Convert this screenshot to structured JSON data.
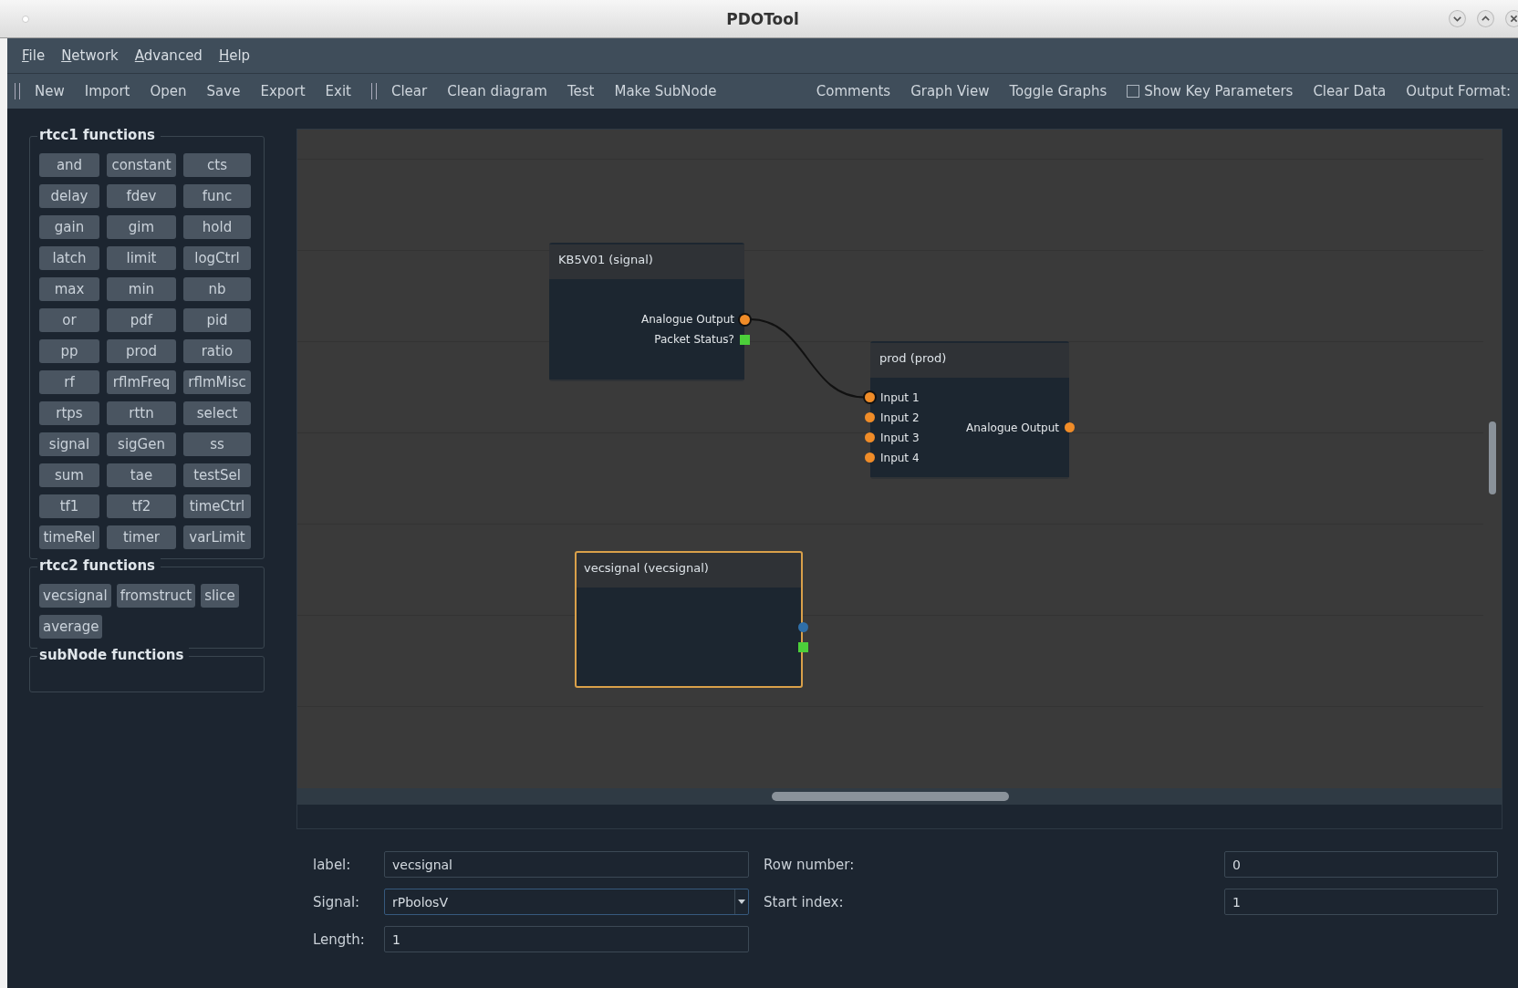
{
  "window": {
    "title": "PDOTool"
  },
  "menu": [
    "File",
    "Network",
    "Advanced",
    "Help"
  ],
  "toolbar": [
    {
      "kind": "grip"
    },
    {
      "kind": "button",
      "label": "New"
    },
    {
      "kind": "button",
      "label": "Import"
    },
    {
      "kind": "button",
      "label": "Open"
    },
    {
      "kind": "button",
      "label": "Save"
    },
    {
      "kind": "button",
      "label": "Export"
    },
    {
      "kind": "button",
      "label": "Exit"
    },
    {
      "kind": "grip"
    },
    {
      "kind": "button",
      "label": "Clear"
    },
    {
      "kind": "button",
      "label": "Clean diagram"
    },
    {
      "kind": "button",
      "label": "Test"
    },
    {
      "kind": "button",
      "label": "Make SubNode"
    },
    {
      "kind": "spacer"
    },
    {
      "kind": "button",
      "label": "Comments"
    },
    {
      "kind": "button",
      "label": "Graph View"
    },
    {
      "kind": "button",
      "label": "Toggle Graphs"
    },
    {
      "kind": "checkbox",
      "label": "Show Key Parameters",
      "checked": false
    },
    {
      "kind": "button",
      "label": "Clear Data"
    },
    {
      "kind": "button",
      "label": "Output Format:"
    }
  ],
  "palette": [
    {
      "title": "rtcc1 functions",
      "items": [
        "and",
        "constant",
        "cts",
        "delay",
        "fdev",
        "func",
        "gain",
        "gim",
        "hold",
        "latch",
        "limit",
        "logCtrl",
        "max",
        "min",
        "nb",
        "or",
        "pdf",
        "pid",
        "pp",
        "prod",
        "ratio",
        "rf",
        "rflmFreq",
        "rflmMisc",
        "rtps",
        "rttn",
        "select",
        "signal",
        "sigGen",
        "ss",
        "sum",
        "tae",
        "testSel",
        "tf1",
        "tf2",
        "timeCtrl",
        "timeRel",
        "timer",
        "varLimit"
      ]
    },
    {
      "title": "rtcc2 functions",
      "items": [
        "vecsignal",
        "fromstruct",
        "slice",
        "average"
      ]
    },
    {
      "title": "subNode functions"
    }
  ],
  "nodes": [
    {
      "title": "KB5V01 (signal)",
      "selected": false,
      "outputs": [
        {
          "label": "Analogue Output",
          "kind": "analogue",
          "connected": true
        },
        {
          "label": "Packet Status?",
          "kind": "status",
          "connected": false
        }
      ]
    },
    {
      "title": "prod (prod)",
      "selected": false,
      "inputs": [
        {
          "label": "Input 1",
          "kind": "analogue",
          "connected": true
        },
        {
          "label": "Input 2",
          "kind": "analogue",
          "connected": false
        },
        {
          "label": "Input 3",
          "kind": "analogue",
          "connected": false
        },
        {
          "label": "Input 4",
          "kind": "analogue",
          "connected": false
        }
      ],
      "outputs": [
        {
          "label": "Analogue Output",
          "kind": "analogue",
          "connected": false
        }
      ]
    },
    {
      "title": "vecsignal (vecsignal)",
      "selected": true,
      "outputs": [
        {
          "kind": "vector",
          "connected": false
        },
        {
          "kind": "status",
          "connected": false
        }
      ]
    }
  ],
  "form": {
    "rows": [
      {
        "fields": [
          {
            "label": "label:",
            "value": "vecsignal",
            "kind": "text"
          },
          {
            "label": "Row number:",
            "value": "0",
            "kind": "text"
          }
        ]
      },
      {
        "fields": [
          {
            "label": "Signal:",
            "value": "rPbolosV",
            "kind": "dropdown"
          },
          {
            "label": "Start index:",
            "value": "1",
            "kind": "text"
          }
        ]
      },
      {
        "fields": [
          {
            "label": "Length:",
            "value": "1",
            "kind": "text"
          }
        ]
      }
    ]
  }
}
